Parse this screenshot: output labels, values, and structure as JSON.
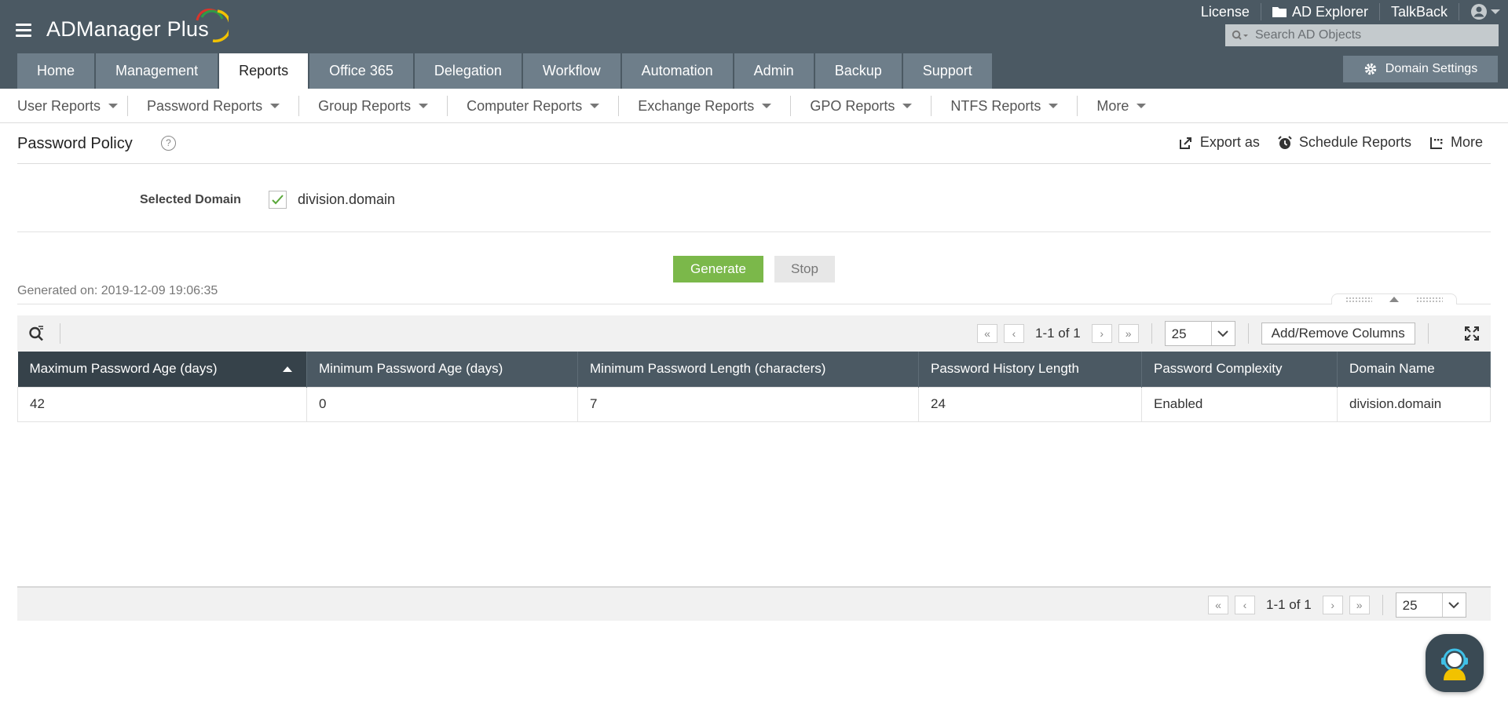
{
  "app": {
    "logo_text": "ADManager Plus"
  },
  "toplinks": {
    "license": "License",
    "ad_explorer": "AD Explorer",
    "talkback": "TalkBack"
  },
  "search": {
    "placeholder": "Search AD Objects"
  },
  "tabs": [
    {
      "label": "Home"
    },
    {
      "label": "Management"
    },
    {
      "label": "Reports",
      "active": true
    },
    {
      "label": "Office 365"
    },
    {
      "label": "Delegation"
    },
    {
      "label": "Workflow"
    },
    {
      "label": "Automation"
    },
    {
      "label": "Admin"
    },
    {
      "label": "Backup"
    },
    {
      "label": "Support"
    }
  ],
  "domain_settings": "Domain Settings",
  "subnav": [
    {
      "label": "User Reports"
    },
    {
      "label": "Password Reports"
    },
    {
      "label": "Group Reports"
    },
    {
      "label": "Computer Reports"
    },
    {
      "label": "Exchange Reports"
    },
    {
      "label": "GPO Reports"
    },
    {
      "label": "NTFS Reports"
    },
    {
      "label": "More"
    }
  ],
  "page": {
    "title": "Password Policy",
    "help": "?",
    "actions": {
      "export": "Export as",
      "schedule": "Schedule Reports",
      "more": "More"
    }
  },
  "domain": {
    "label": "Selected Domain",
    "value": "division.domain",
    "checked": true
  },
  "buttons": {
    "generate": "Generate",
    "stop": "Stop"
  },
  "generated_on": "Generated on: 2019-12-09 19:06:35",
  "pager": {
    "range": "1-1 of 1",
    "page_size": "25",
    "add_remove_columns": "Add/Remove Columns"
  },
  "table": {
    "columns": [
      "Maximum Password Age (days)",
      "Minimum Password Age (days)",
      "Minimum Password Length (characters)",
      "Password History Length",
      "Password Complexity",
      "Domain Name"
    ],
    "sorted_column": 0,
    "rows": [
      [
        "42",
        "0",
        "7",
        "24",
        "Enabled",
        "division.domain"
      ]
    ]
  },
  "colors": {
    "header_bg": "#4b5963",
    "tab_bg": "#6e7e8a",
    "generate_green": "#7bb84a"
  }
}
